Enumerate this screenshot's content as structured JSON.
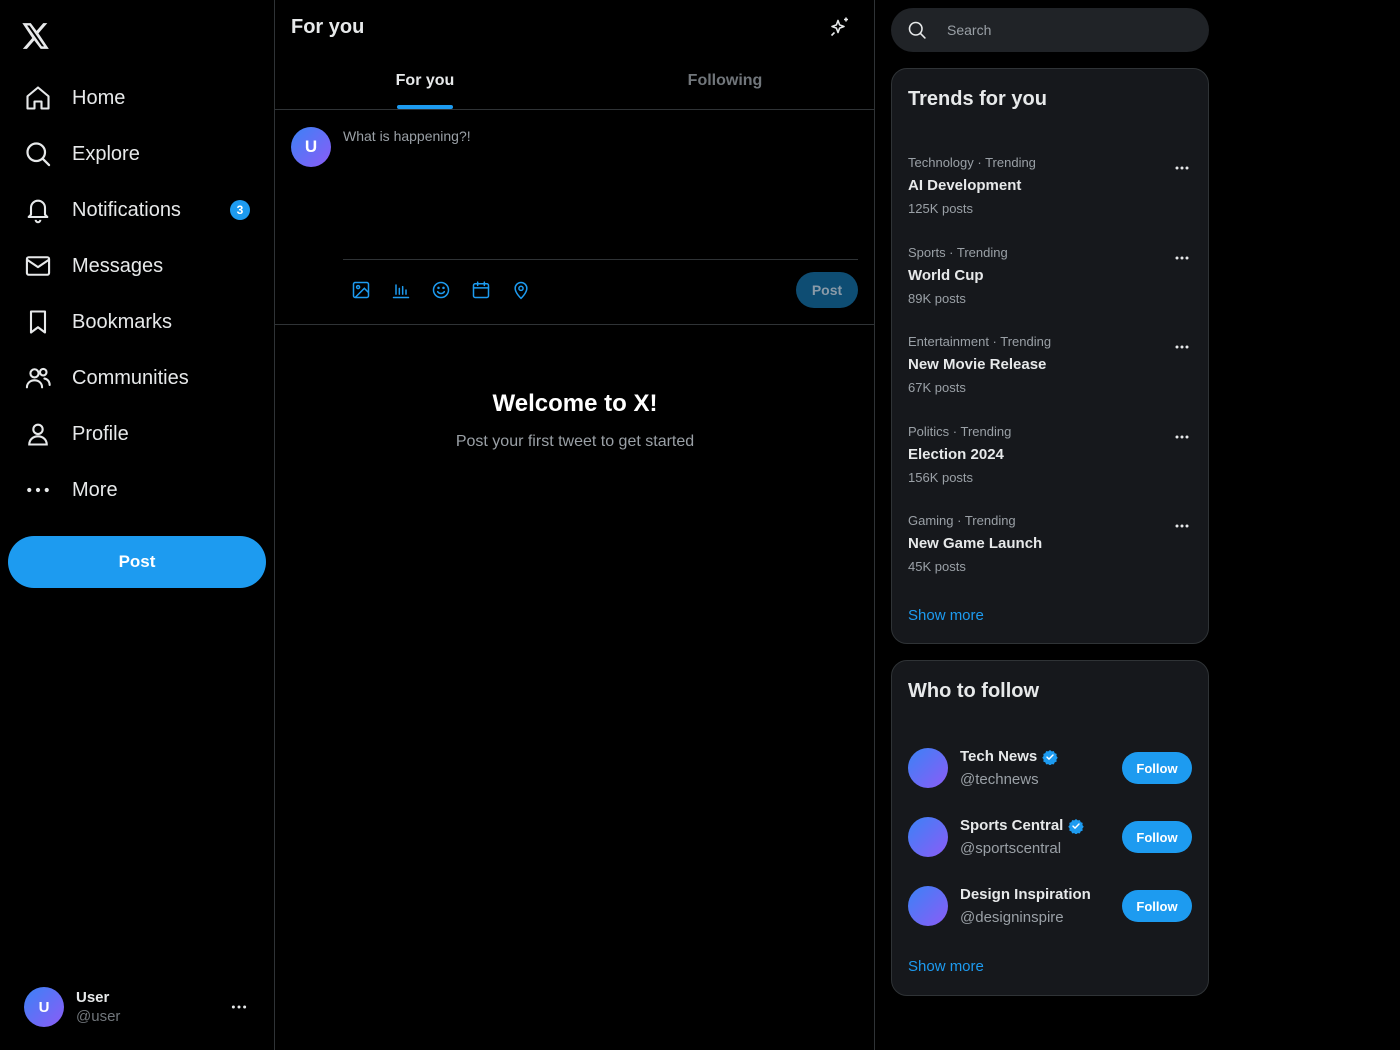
{
  "sidebar": {
    "nav": [
      {
        "label": "Home",
        "icon": "home-icon"
      },
      {
        "label": "Explore",
        "icon": "search-icon"
      },
      {
        "label": "Notifications",
        "icon": "bell-icon",
        "badge": "3"
      },
      {
        "label": "Messages",
        "icon": "envelope-icon"
      },
      {
        "label": "Bookmarks",
        "icon": "bookmark-icon"
      },
      {
        "label": "Communities",
        "icon": "people-icon"
      },
      {
        "label": "Profile",
        "icon": "person-icon"
      },
      {
        "label": "More",
        "icon": "more-dots-icon"
      }
    ],
    "post_label": "Post",
    "account": {
      "avatar_letter": "U",
      "name": "User",
      "handle": "@user"
    }
  },
  "main": {
    "title": "For you",
    "tabs": [
      {
        "label": "For you",
        "active": true
      },
      {
        "label": "Following",
        "active": false
      }
    ],
    "composer": {
      "avatar_letter": "U",
      "placeholder": "What is happening?!",
      "post_label": "Post",
      "tools": [
        "image-icon",
        "poll-icon",
        "emoji-icon",
        "schedule-icon",
        "location-icon"
      ]
    },
    "welcome": {
      "title": "Welcome to X!",
      "subtitle": "Post your first tweet to get started"
    }
  },
  "right": {
    "search_placeholder": "Search",
    "trends": {
      "title": "Trends for you",
      "items": [
        {
          "meta": "Technology · Trending",
          "name": "AI Development",
          "count": "125K posts"
        },
        {
          "meta": "Sports · Trending",
          "name": "World Cup",
          "count": "89K posts"
        },
        {
          "meta": "Entertainment · Trending",
          "name": "New Movie Release",
          "count": "67K posts"
        },
        {
          "meta": "Politics · Trending",
          "name": "Election 2024",
          "count": "156K posts"
        },
        {
          "meta": "Gaming · Trending",
          "name": "New Game Launch",
          "count": "45K posts"
        }
      ],
      "show_more": "Show more"
    },
    "who_to_follow": {
      "title": "Who to follow",
      "items": [
        {
          "name": "Tech News",
          "handle": "@technews",
          "verified": true,
          "button": "Follow"
        },
        {
          "name": "Sports Central",
          "handle": "@sportscentral",
          "verified": true,
          "button": "Follow"
        },
        {
          "name": "Design Inspiration",
          "handle": "@designinspire",
          "verified": false,
          "button": "Follow"
        }
      ],
      "show_more": "Show more"
    }
  },
  "colors": {
    "accent": "#1d9bf0",
    "background": "#000000",
    "card": "#16181c",
    "border": "#2f3336",
    "text": "#e7e9ea",
    "muted": "#71767b"
  }
}
